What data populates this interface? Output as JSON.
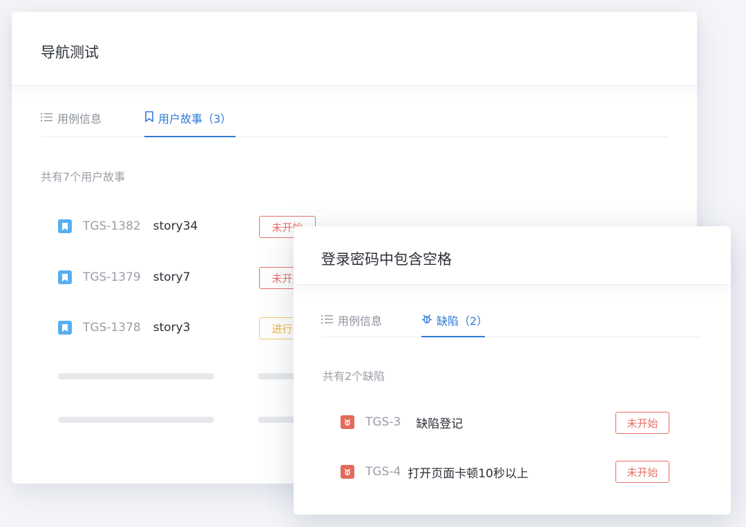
{
  "back_card": {
    "title": "导航测试",
    "tabs": [
      {
        "label": "用例信息",
        "icon": "list-icon",
        "active": false
      },
      {
        "label": "用户故事（3）",
        "icon": "bookmark-icon",
        "active": true
      }
    ],
    "summary": "共有7个用户故事",
    "stories": [
      {
        "id": "TGS-1382",
        "name": "story34",
        "status": "未开始"
      },
      {
        "id": "TGS-1379",
        "name": "story7",
        "status": "未开始"
      },
      {
        "id": "TGS-1378",
        "name": "story3",
        "status": "进行中"
      }
    ]
  },
  "front_card": {
    "title": "登录密码中包含空格",
    "tabs": [
      {
        "label": "用例信息",
        "icon": "list-icon",
        "active": false
      },
      {
        "label": "缺陷（2）",
        "icon": "bug-icon",
        "active": true
      }
    ],
    "summary": "共有2个缺陷",
    "defects": [
      {
        "id": "TGS-3",
        "name": "缺陷登记",
        "status": "未开始"
      },
      {
        "id": "TGS-4",
        "name": "打开页面卡顿10秒以上",
        "status": "未开始"
      }
    ]
  },
  "colors": {
    "accent": "#2f7bd8",
    "story_icon": "#58aef1",
    "bug_icon": "#e46a5c",
    "status_not_started": "#e57166",
    "status_in_progress": "#efb23b"
  }
}
